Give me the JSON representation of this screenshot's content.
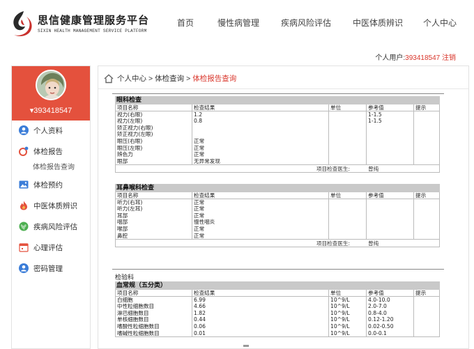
{
  "brand": {
    "title": "思信健康管理服务平台",
    "subtitle": "SIXIN HEALTH MANAGEMENT SERVICE PLATFORM",
    "accent": "#d9362b"
  },
  "nav": {
    "items": [
      {
        "label": "首页"
      },
      {
        "label": "慢性病管理"
      },
      {
        "label": "疾病风险评估"
      },
      {
        "label": "中医体质辨识"
      },
      {
        "label": "个人中心"
      }
    ]
  },
  "userbar": {
    "prefix": "个人用户:",
    "user_id": "393418547",
    "logout": "注销"
  },
  "sidebar": {
    "header_color": "#e4513d",
    "username": "393418547",
    "items": [
      {
        "label": "个人资料",
        "icon": "user-icon"
      },
      {
        "label": "体检报告",
        "icon": "report-icon"
      },
      {
        "label": "体检预约",
        "icon": "picture-icon"
      },
      {
        "label": "中医体质辨识",
        "icon": "fire-icon"
      },
      {
        "label": "疾病风险评估",
        "icon": "globe-icon"
      },
      {
        "label": "心理评估",
        "icon": "calendar-icon"
      },
      {
        "label": "密码管理",
        "icon": "user-lock-icon"
      }
    ],
    "sub_item": "体检报告查询"
  },
  "breadcrumb": {
    "items": [
      "个人中心",
      "体检查询"
    ],
    "current": "体检报告查询",
    "separator": ">"
  },
  "report": {
    "headers": [
      "项目名称",
      "检查结果",
      "单位",
      "参考值",
      "提示"
    ],
    "doctor_label": "项目检查医生:",
    "lab_dept": "检验科",
    "sections": [
      {
        "title": "眼科检查",
        "rows": [
          [
            "视力(右眼)",
            "1.2",
            "",
            "1-1.5",
            ""
          ],
          [
            "视力(左眼)",
            "0.8",
            "",
            "1-1.5",
            ""
          ],
          [
            "矫正视力(右眼)",
            "",
            "",
            "",
            ""
          ],
          [
            "矫正视力(左眼)",
            "",
            "",
            "",
            ""
          ],
          [
            "眼压(右眼)",
            "正常",
            "",
            "",
            ""
          ],
          [
            "眼压(左眼)",
            "正常",
            "",
            "",
            ""
          ],
          [
            "辨色力",
            "正常",
            "",
            "",
            ""
          ],
          [
            "眼部",
            "无异常发现",
            "",
            "",
            ""
          ]
        ],
        "doctor": "曾纯"
      },
      {
        "title": "耳鼻喉科检查",
        "rows": [
          [
            "听力(右耳)",
            "正常",
            "",
            "",
            ""
          ],
          [
            "听力(左耳)",
            "正常",
            "",
            "",
            ""
          ],
          [
            "耳部",
            "正常",
            "",
            "",
            ""
          ],
          [
            "咽部",
            "慢性咽炎",
            "",
            "",
            ""
          ],
          [
            "喉部",
            "正常",
            "",
            "",
            ""
          ],
          [
            "鼻腔",
            "正常",
            "",
            "",
            ""
          ]
        ],
        "doctor": "曾纯"
      },
      {
        "title": "血常规（五分类）",
        "rows": [
          [
            "白细胞",
            "6.99",
            "10^9/L",
            "4.0-10.0",
            ""
          ],
          [
            "中性粒细胞数目",
            "4.66",
            "10^9/L",
            "2.0-7.0",
            ""
          ],
          [
            "淋巴细胞数目",
            "1.82",
            "10^9/L",
            "0.8-4.0",
            ""
          ],
          [
            "单核细胞数目",
            "0.44",
            "10^9/L",
            "0.12-1.20",
            ""
          ],
          [
            "嗜酸性粒细胞数目",
            "0.06",
            "10^9/L",
            "0.02-0.50",
            ""
          ],
          [
            "嗜碱性粒细胞数目",
            "0.01",
            "10^9/L",
            "0.0-0.1",
            ""
          ]
        ]
      }
    ]
  }
}
